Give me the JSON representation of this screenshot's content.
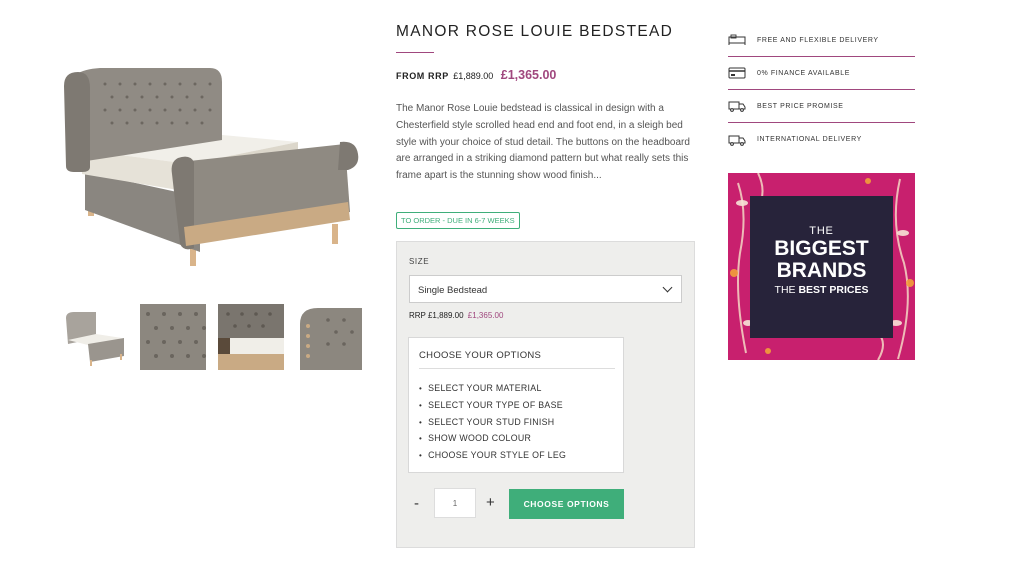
{
  "product": {
    "title": "MANOR ROSE LOUIE BEDSTEAD",
    "from_label": "FROM RRP",
    "rrp_price": "£1,889.00",
    "price": "£1,365.00",
    "description": "The Manor Rose Louie bedstead is classical in design with a Chesterfield style scrolled head end and foot end, in a sleigh bed style with your choice of stud detail. The buttons on the headboard are arranged in a striking diamond pattern but what really sets this frame apart is the stunning show wood finish...",
    "stock_badge": "TO ORDER - DUE IN 6-7 WEEKS"
  },
  "options": {
    "size_label": "SIZE",
    "size_selected": "Single Bedstead",
    "selected_rrp_label": "RRP £1,889.00",
    "selected_price": "£1,365.00",
    "choose_title": "CHOOSE YOUR OPTIONS",
    "choose_items": [
      "SELECT YOUR MATERIAL",
      "SELECT YOUR TYPE OF BASE",
      "SELECT YOUR STUD FINISH",
      "SHOW WOOD COLOUR",
      "CHOOSE YOUR STYLE OF LEG"
    ],
    "qty_minus": "-",
    "qty_value": "1",
    "qty_plus": "+",
    "cta_label": "CHOOSE OPTIONS"
  },
  "usps": [
    {
      "icon": "bed-delivery-icon",
      "label": "FREE AND FLEXIBLE DELIVERY"
    },
    {
      "icon": "credit-card-icon",
      "label": "0% FINANCE AVAILABLE"
    },
    {
      "icon": "truck-icon",
      "label": "BEST PRICE PROMISE"
    },
    {
      "icon": "truck-icon",
      "label": "INTERNATIONAL DELIVERY"
    }
  ],
  "promo": {
    "line1": "THE",
    "line2a": "BIGGEST",
    "line2b": "BRANDS",
    "line3a": "THE ",
    "line3b": "BEST PRICES"
  },
  "colors": {
    "accent": "#a0477e",
    "success": "#3fae7a",
    "promo_bg": "#c8206e",
    "promo_card": "#27233a"
  }
}
